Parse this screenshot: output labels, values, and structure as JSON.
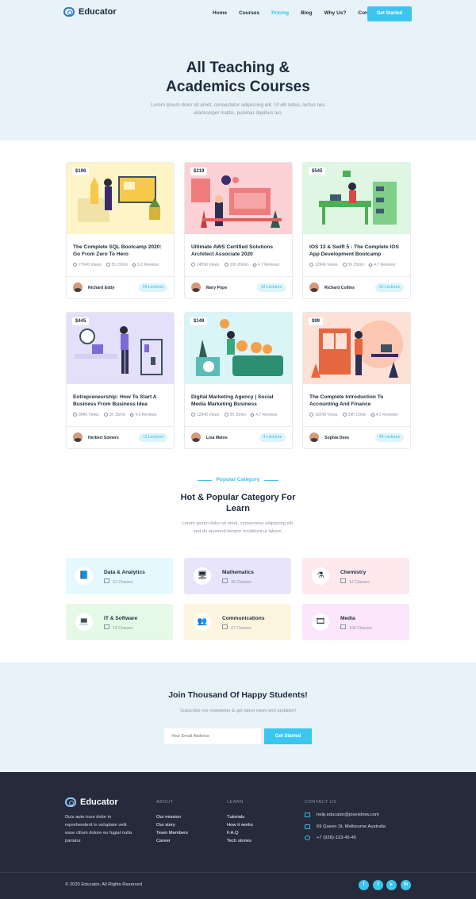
{
  "header": {
    "brand": "Educator",
    "nav": [
      "Home",
      "Courses",
      "Pricing",
      "Blog",
      "Why Us?",
      "Contacts"
    ],
    "active_nav": "Pricing",
    "cta": "Get Started"
  },
  "hero": {
    "title_line1": "All Teaching &",
    "title_line2": "Academics Courses",
    "subtitle": "Lorem ipsum dolor sit amet, consectetur adipiscing elit. Ut elit tellus, luctus nec ullamcorper mattis, pulvinar dapibus leo."
  },
  "courses": [
    {
      "price": "$196",
      "title": "The Complete SQL Bootcamp 2020: Go From Zero To Hero",
      "views": "77045 Views",
      "duration": "3h 15min",
      "reviews": "5.0 Reviews",
      "author": "Richard Eddy",
      "lectures": "24 Lectures",
      "bg": "#fdf4c8"
    },
    {
      "price": "$219",
      "title": "Ultimate AWS Certified Solutions Architect Associate 2020",
      "views": "14590 Views",
      "duration": "10h 20min",
      "reviews": "4.7 Reviews",
      "author": "Mary Pope",
      "lectures": "12 Lectures",
      "bg": "#fbd1d6"
    },
    {
      "price": "$545",
      "title": "IOS 13 & Swift 5 - The Complete IOS App Development Bootcamp",
      "views": "12940 Views",
      "duration": "5h 15min",
      "reviews": "4.7 Reviews",
      "author": "Richard Collins",
      "lectures": "32 Lectures",
      "bg": "#dff7e2"
    },
    {
      "price": "$445",
      "title": "Entrepreneurship: How To Start A Business From Business Idea",
      "views": "9940 Views",
      "duration": "3h 15min",
      "reviews": "4.9 Reviews",
      "author": "Herbert Somers",
      "lectures": "11 Lectures",
      "bg": "#e4e0f9"
    },
    {
      "price": "$149",
      "title": "Digital Marketing Agency | Social Media Marketing Business",
      "views": "12940 Views",
      "duration": "5h 15min",
      "reviews": "4.7 Reviews",
      "author": "Lisa Matos",
      "lectures": "4 Lectures",
      "bg": "#d9f5f7"
    },
    {
      "price": "$99",
      "title": "The Complete Introduction To Accounting And Finance",
      "views": "19240 Views",
      "duration": "39h 15min",
      "reviews": "4.2 Reviews",
      "author": "Sophia Dees",
      "lectures": "49 Lectures",
      "bg": "#fde1d7"
    }
  ],
  "popular": {
    "tag": "Popular Category",
    "title_line1": "Hot & Popular Category For",
    "title_line2": "Learn",
    "subtitle": "Lorem ipsum dolor sit amet, consectetur adipiscing elit, sed do eiusmod tempor incididunt ut labore."
  },
  "categories": [
    {
      "name": "Data & Analytics",
      "count": "51 Classes",
      "icon": "book-icon",
      "bg": "#e3f9fd"
    },
    {
      "name": "Mathematics",
      "count": "36 Classes",
      "icon": "monitor-icon",
      "bg": "#e8e5fb"
    },
    {
      "name": "Chemistry",
      "count": "12 Classes",
      "icon": "flask-icon",
      "bg": "#fde8ee"
    },
    {
      "name": "IT & Software",
      "count": "74 Classes",
      "icon": "laptop-icon",
      "bg": "#e5f9e6"
    },
    {
      "name": "Communications",
      "count": "47 Classes",
      "icon": "people-icon",
      "bg": "#fdf5e0"
    },
    {
      "name": "Media",
      "count": "106 Classes",
      "icon": "media-icon",
      "bg": "#fbe6fb"
    }
  ],
  "newsletter": {
    "title": "Join Thousand Of Happy Students!",
    "subtitle": "Subscribe our newsletter & get latest news and updation!",
    "placeholder": "Your Email Address",
    "button": "Get Started"
  },
  "footer": {
    "brand": "Educator",
    "description": "Duis aute irure dolor in reprehenderit in voluptate velit esse cillum dolore eu fugiat nulla pariatur.",
    "about_heading": "ABOUT",
    "about_links": [
      "Our mission",
      "Our story",
      "Team Members",
      "Career"
    ],
    "learn_heading": "LEARN",
    "learn_links": [
      "Tutorials",
      "How it works",
      "F.A.Q",
      "Tech stories"
    ],
    "contact_heading": "CONTACT US",
    "email": "help.educator@pixelshow.com",
    "address": "69 Queen St, Melbourne Australia",
    "phone": "+7 (928)-123-45-45",
    "copyright": "© 2020 Educator, All Rights Reserved",
    "social": [
      "facebook-icon",
      "twitter-icon",
      "youtube-icon",
      "linkedin-icon"
    ]
  }
}
